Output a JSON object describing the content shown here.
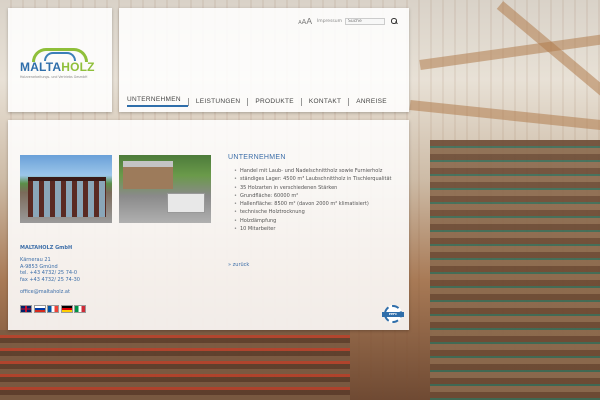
{
  "logo": {
    "name_part1": "MALTA",
    "name_part2": "HOLZ",
    "tagline": "Holzverarbeitungs- und Vertriebs GesmbH"
  },
  "header": {
    "font_size": {
      "small": "A",
      "medium": "A",
      "large": "A"
    },
    "impressum": "Impressum",
    "search_placeholder": "Suche"
  },
  "nav": {
    "items": [
      {
        "label": "UNTERNEHMEN",
        "active": true
      },
      {
        "label": "LEISTUNGEN"
      },
      {
        "label": "PRODUKTE"
      },
      {
        "label": "KONTAKT"
      },
      {
        "label": "ANREISE"
      }
    ]
  },
  "sidebar": {
    "company": "MALTAHOLZ GmbH",
    "street": "Kärnerau 21",
    "city": "A-9853 Gmünd",
    "tel": "tel. +43 4732/ 25 74-0",
    "fax": "fax +43 4732/ 25 74-30",
    "email": "office@maltaholz.at"
  },
  "content": {
    "title": "UNTERNEHMEN",
    "bullets": [
      "Handel mit Laub- und Nadelschnittholz sowie Furnierholz",
      "ständiges Lager: 4500 m³ Laubschnittholz in Tischlerqualität",
      "35 Holzarten in verschiedenen Stärken",
      "Grundfläche: 60000 m²",
      "Hallenfläche: 8500 m² (davon 2000 m² klimatisiert)",
      "technische Holztrocknung",
      "Holzdämpfung",
      "10 Mitarbeiter"
    ],
    "back_link": "» zurück"
  },
  "badge": {
    "label": "PEFC"
  },
  "colors": {
    "brand_blue": "#2f6eaa",
    "brand_green": "#8fbf3a",
    "link_blue": "#3c6ea8"
  }
}
